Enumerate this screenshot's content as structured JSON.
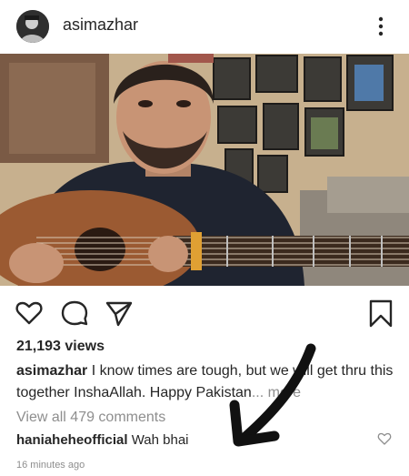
{
  "header": {
    "username": "asimazhar",
    "avatar_icon": "user-avatar-icon",
    "menu_icon": "more-vertical-icon"
  },
  "actions": {
    "like_icon": "heart-icon",
    "comment_icon": "comment-icon",
    "share_icon": "send-icon",
    "save_icon": "bookmark-icon"
  },
  "post": {
    "views": "21,193 views",
    "caption_user": "asimazhar",
    "caption_text": " I know times are tough, but we will get thru this together InshaAllah. Happy Pakistan",
    "caption_more": "... more",
    "view_comments": "View all 479 comments",
    "comment_user": "haniaheheofficial",
    "comment_text": " Wah bhai",
    "timestamp": "16 minutes ago"
  },
  "colors": {
    "text": "#262626",
    "muted": "#8e8e8e",
    "annotation": "#111111"
  }
}
